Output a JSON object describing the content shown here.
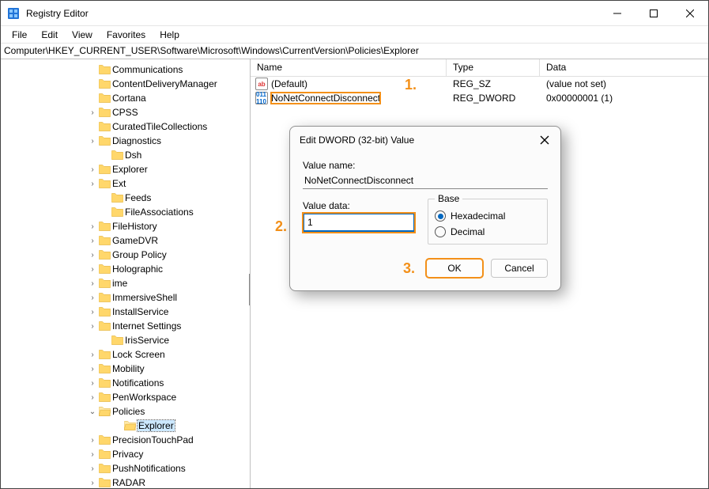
{
  "app": {
    "title": "Registry Editor"
  },
  "menubar": [
    "File",
    "Edit",
    "View",
    "Favorites",
    "Help"
  ],
  "address": "Computer\\HKEY_CURRENT_USER\\Software\\Microsoft\\Windows\\CurrentVersion\\Policies\\Explorer",
  "tree": [
    {
      "indent": 109,
      "chev": "",
      "label": "Communications"
    },
    {
      "indent": 109,
      "chev": "",
      "label": "ContentDeliveryManager"
    },
    {
      "indent": 109,
      "chev": "",
      "label": "Cortana"
    },
    {
      "indent": 109,
      "chev": ">",
      "label": "CPSS"
    },
    {
      "indent": 109,
      "chev": "",
      "label": "CuratedTileCollections"
    },
    {
      "indent": 109,
      "chev": ">",
      "label": "Diagnostics"
    },
    {
      "indent": 125,
      "chev": "",
      "label": "Dsh"
    },
    {
      "indent": 109,
      "chev": ">",
      "label": "Explorer"
    },
    {
      "indent": 109,
      "chev": ">",
      "label": "Ext"
    },
    {
      "indent": 125,
      "chev": "",
      "label": "Feeds"
    },
    {
      "indent": 125,
      "chev": "",
      "label": "FileAssociations"
    },
    {
      "indent": 109,
      "chev": ">",
      "label": "FileHistory"
    },
    {
      "indent": 109,
      "chev": ">",
      "label": "GameDVR"
    },
    {
      "indent": 109,
      "chev": ">",
      "label": "Group Policy"
    },
    {
      "indent": 109,
      "chev": ">",
      "label": "Holographic"
    },
    {
      "indent": 109,
      "chev": ">",
      "label": "ime"
    },
    {
      "indent": 109,
      "chev": ">",
      "label": "ImmersiveShell"
    },
    {
      "indent": 109,
      "chev": ">",
      "label": "InstallService"
    },
    {
      "indent": 109,
      "chev": ">",
      "label": "Internet Settings"
    },
    {
      "indent": 125,
      "chev": "",
      "label": "IrisService"
    },
    {
      "indent": 109,
      "chev": ">",
      "label": "Lock Screen"
    },
    {
      "indent": 109,
      "chev": ">",
      "label": "Mobility"
    },
    {
      "indent": 109,
      "chev": ">",
      "label": "Notifications"
    },
    {
      "indent": 109,
      "chev": ">",
      "label": "PenWorkspace"
    },
    {
      "indent": 109,
      "chev": "v",
      "label": "Policies",
      "open": true
    },
    {
      "indent": 141,
      "chev": "",
      "label": "Explorer",
      "selected": true
    },
    {
      "indent": 109,
      "chev": ">",
      "label": "PrecisionTouchPad"
    },
    {
      "indent": 109,
      "chev": ">",
      "label": "Privacy"
    },
    {
      "indent": 109,
      "chev": ">",
      "label": "PushNotifications"
    },
    {
      "indent": 109,
      "chev": ">",
      "label": "RADAR"
    }
  ],
  "values": {
    "headers": {
      "name": "Name",
      "type": "Type",
      "data": "Data"
    },
    "rows": [
      {
        "icon": "ab",
        "name": "(Default)",
        "type": "REG_SZ",
        "data": "(value not set)",
        "highlight": false
      },
      {
        "icon": "dw",
        "name": "NoNetConnectDisconnect",
        "type": "REG_DWORD",
        "data": "0x00000001 (1)",
        "highlight": true
      }
    ]
  },
  "annotations": {
    "one": "1.",
    "two": "2.",
    "three": "3."
  },
  "dialog": {
    "title": "Edit DWORD (32-bit) Value",
    "value_name_label": "Value name:",
    "value_name": "NoNetConnectDisconnect",
    "value_data_label": "Value data:",
    "value_data": "1",
    "base_label": "Base",
    "radio_hex": "Hexadecimal",
    "radio_dec": "Decimal",
    "ok": "OK",
    "cancel": "Cancel"
  }
}
